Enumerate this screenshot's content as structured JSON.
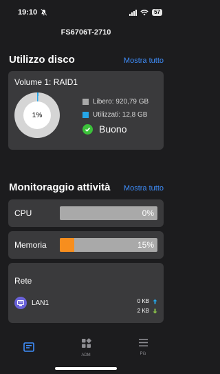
{
  "status_bar": {
    "time": "19:10",
    "battery": "57"
  },
  "device_title": "FS6706T-2710",
  "disk_usage": {
    "title": "Utilizzo disco",
    "show_all": "Mostra tutto",
    "volume": {
      "name": "Volume 1: RAID1",
      "used_percent_label": "1%",
      "used_fraction": 0.01,
      "free_label": "Libero: 920,79 GB",
      "used_label": "Utilizzati: 12,8 GB",
      "health": "Buono",
      "colors": {
        "free": "#a9a9a9",
        "used": "#25a6e8",
        "health": "#3cc13b"
      }
    }
  },
  "activity": {
    "title": "Monitoraggio attività",
    "show_all": "Mostra tutto",
    "cpu": {
      "label": "CPU",
      "value_label": "0%",
      "fraction": 0.0
    },
    "memory": {
      "label": "Memoria",
      "value_label": "15%",
      "fraction": 0.15,
      "color": "#f78e1e"
    },
    "network": {
      "title": "Rete",
      "interface": "LAN1",
      "upload": "0 KB",
      "download": "2 KB",
      "upload_color": "#25a6e8",
      "download_color": "#8bc34a"
    }
  },
  "tabbar": {
    "tabs": [
      {
        "label": "",
        "icon": "dashboard-icon",
        "active": true
      },
      {
        "label": "ADM",
        "icon": "apps-grid-icon",
        "active": false
      },
      {
        "label": "Più",
        "icon": "menu-icon",
        "active": false
      }
    ]
  }
}
